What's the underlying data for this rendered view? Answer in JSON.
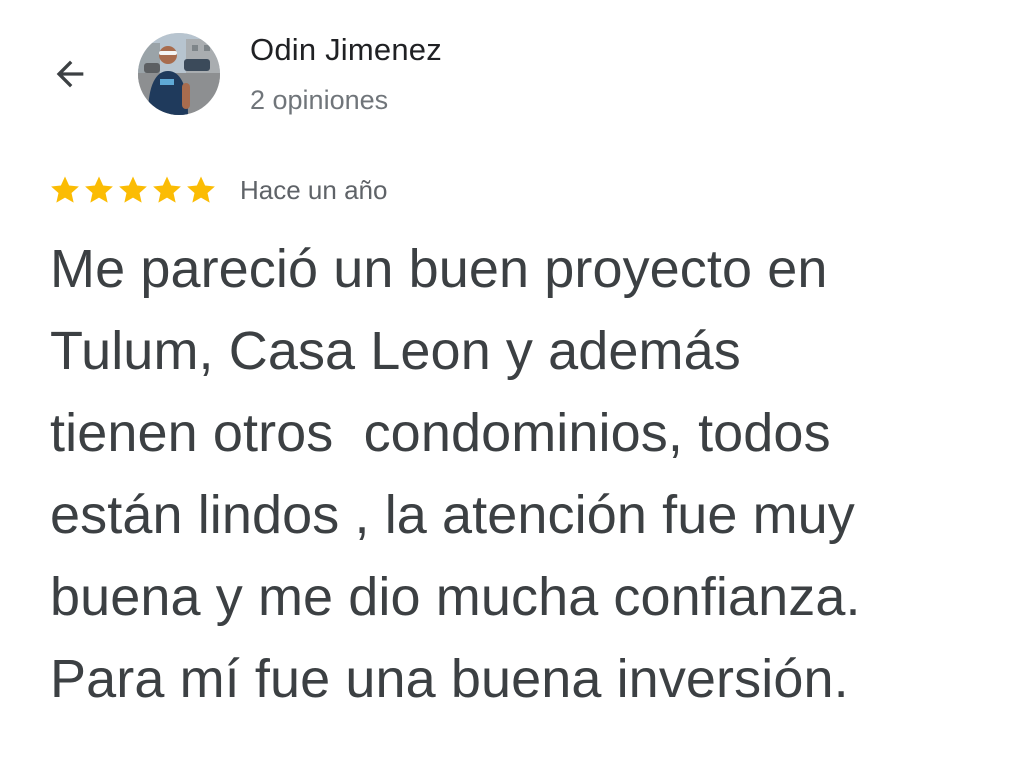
{
  "header": {
    "back_icon": "arrow-left-icon",
    "reviewer_name": "Odin Jimenez",
    "reviewer_meta": "2 opiniones",
    "avatar_icon": "profile-photo"
  },
  "review": {
    "rating": 5,
    "rating_max": 5,
    "star_color": "#fbbc04",
    "date": "Hace un año",
    "text": "Me pareció un buen proyecto en\nTulum, Casa Leon y además\ntienen otros  condominios, todos\nestán lindos , la atención fue muy\nbuena y me dio mucha confianza.\nPara mí fue una buena inversión."
  }
}
